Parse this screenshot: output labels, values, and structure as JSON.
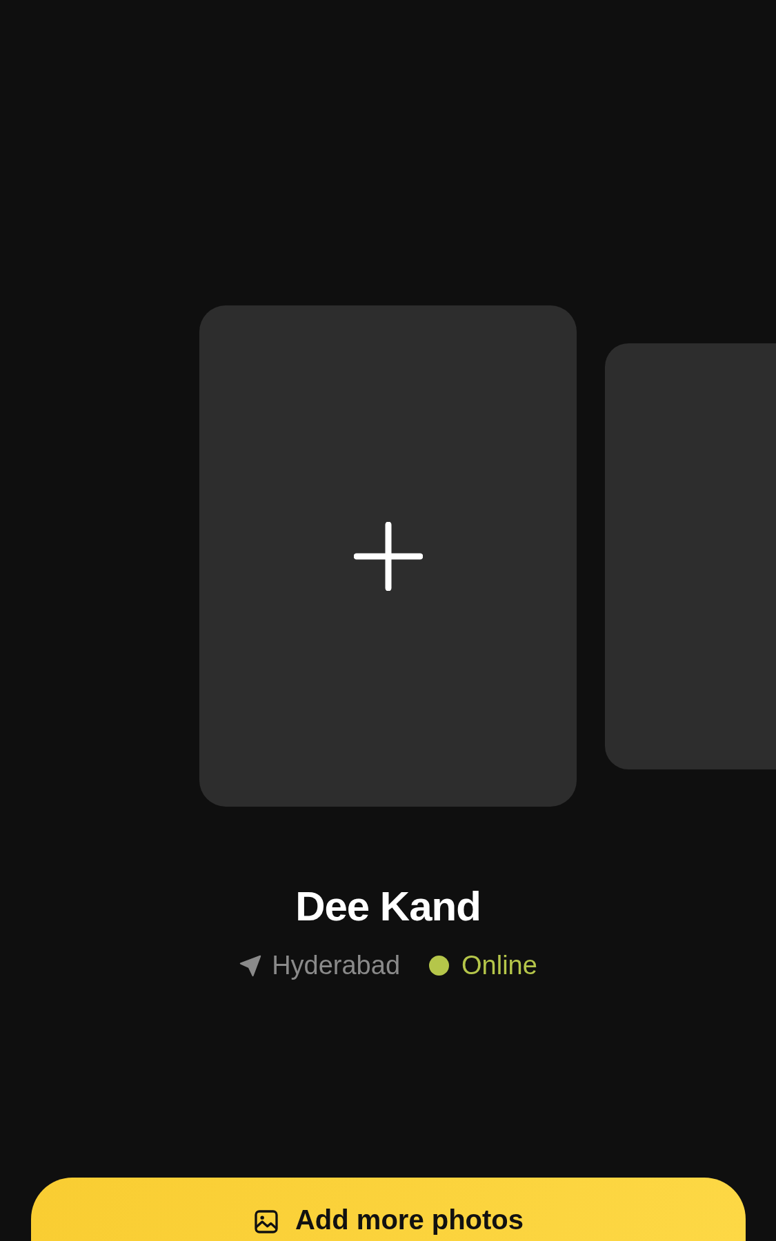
{
  "photo_cards": [
    {
      "kind": "add"
    },
    {
      "kind": "empty"
    }
  ],
  "profile": {
    "name": "Dee Kand",
    "location": "Hyderabad",
    "status": {
      "label": "Online",
      "online": true
    }
  },
  "action_button": {
    "label": "Add more photos"
  }
}
